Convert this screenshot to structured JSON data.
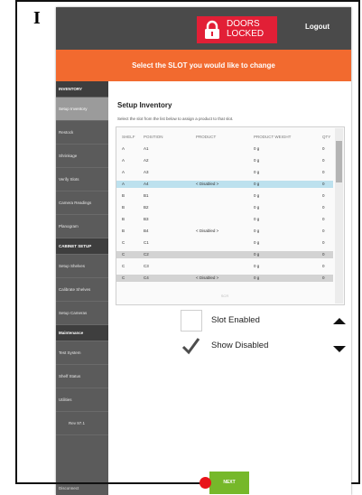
{
  "figure": {
    "label": "I"
  },
  "colors": {
    "topbar": "#4a4a4a",
    "banner": "#f26a2f",
    "lock": "#e21f36",
    "sidebar": "#5b5b5b",
    "next": "#76b82a",
    "selected_row": "#bde1ee"
  },
  "header": {
    "lock_line1": "DOORS",
    "lock_line2": "LOCKED",
    "logout": "Logout"
  },
  "banner": {
    "text": "Select the SLOT you would like to change"
  },
  "sidebar": {
    "items": [
      {
        "label": "INVENTORY"
      },
      {
        "label": "Setup Inventory"
      },
      {
        "label": "Restock"
      },
      {
        "label": "Shrinkage"
      },
      {
        "label": "Verify Slots"
      },
      {
        "label": "Camera Readings"
      },
      {
        "label": "Planogram"
      },
      {
        "label": "CABINET SETUP"
      },
      {
        "label": "Setup Shelves"
      },
      {
        "label": "Calibrate Shelves"
      },
      {
        "label": "Setup Cameras"
      },
      {
        "label": "Maintenance"
      },
      {
        "label": "Test System"
      },
      {
        "label": "Shelf Status"
      },
      {
        "label": "Utilities"
      },
      {
        "label": "Rev 97.1"
      }
    ],
    "footer": "Disconnect"
  },
  "main": {
    "title": "Setup Inventory",
    "subtitle": "Select the slot from the list below to assign a product to that slot.",
    "columns": [
      "SHELF",
      "POSITION",
      "PRODUCT",
      "PRODUCT WEIGHT",
      "QTY"
    ],
    "rows": [
      [
        "A",
        "A1",
        "",
        "0 g",
        "0"
      ],
      [
        "A",
        "A2",
        "",
        "0 g",
        "0"
      ],
      [
        "A",
        "A3",
        "",
        "0 g",
        "0"
      ],
      [
        "A",
        "A4",
        "< Disabled >",
        "0 g",
        "0"
      ],
      [
        "B",
        "B1",
        "",
        "0 g",
        "0"
      ],
      [
        "B",
        "B2",
        "",
        "0 g",
        "0"
      ],
      [
        "B",
        "B3",
        "",
        "0 g",
        "0"
      ],
      [
        "B",
        "B4",
        "< Disabled >",
        "0 g",
        "0"
      ],
      [
        "C",
        "C1",
        "",
        "0 g",
        "0"
      ],
      [
        "C",
        "C2",
        "",
        "0 g",
        "0"
      ],
      [
        "C",
        "C3",
        "",
        "0 g",
        "0"
      ],
      [
        "C",
        "C4",
        "< Disabled >",
        "0 g",
        "0"
      ]
    ],
    "table_footer": "SCR",
    "slot_enabled": {
      "label": "Slot Enabled",
      "checked": false
    },
    "show_disabled": {
      "label": "Show Disabled",
      "checked": true
    },
    "next": "NEXT"
  }
}
